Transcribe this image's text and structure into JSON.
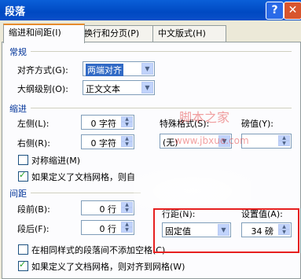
{
  "window": {
    "title": "段落",
    "help": "?",
    "close": "✕"
  },
  "tabs": [
    {
      "label": "缩进和间距(I)"
    },
    {
      "label": "换行和分页(P)"
    },
    {
      "label": "中文版式(H)"
    }
  ],
  "general": {
    "section": "常规",
    "align_label": "对齐方式(G):",
    "align_value": "两端对齐",
    "outline_label": "大纲级别(O):",
    "outline_value": "正文文本"
  },
  "indent": {
    "section": "缩进",
    "left_label": "左侧(L):",
    "left_value": "0 字符",
    "right_label": "右侧(R):",
    "right_value": "0 字符",
    "special_label": "特殊格式(S):",
    "special_value": "(无)",
    "by_label": "磅值(Y):",
    "by_value": "",
    "mirror_label": "对称缩进(M)",
    "mirror_checked": false,
    "grid_label": "如果定义了文档网格，则自",
    "grid_checked": true
  },
  "spacing": {
    "section": "间距",
    "before_label": "段前(B):",
    "before_value": "0 行",
    "after_label": "段后(F):",
    "after_value": "0 行",
    "line_label": "行距(N):",
    "line_value": "固定值",
    "at_label": "设置值(A):",
    "at_value": "34 磅",
    "nospace_label": "在相同样式的段落间不添加空格(C)",
    "nospace_checked": false,
    "snap_label": "如果定义了文档网格，则对齐到网格(W)",
    "snap_checked": true
  },
  "watermark": {
    "brand": "脚本之家",
    "url": "www.jbxue.com"
  },
  "icons": {
    "dropdown": "▼",
    "spin_up": "▲",
    "spin_down": "▼"
  },
  "colors": {
    "titlebar": "#0049c2",
    "section": "#003399",
    "highlight": "#e62020",
    "tab_accent": "#e68b2c"
  }
}
